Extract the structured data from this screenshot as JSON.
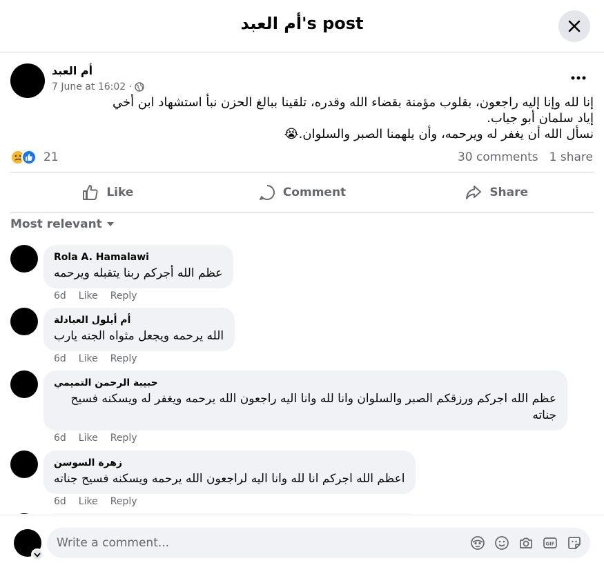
{
  "header": {
    "title": "أم العبد's post"
  },
  "post": {
    "author": "أم العبد",
    "timestamp": "7 June at 16:02 ·",
    "privacy_icon": "globe-icon",
    "lines": [
      "إنا لله وإنا إليه راجعون، بقلوب مؤمنة بقضاء الله وقدره، تلقينا ببالغ الحزن نبأ استشهاد ابن أخي",
      "إياد سلمان أبو جياب.",
      "نسأل الله أن يغفر له ويرحمه، وأن يلهمنا الصبر والسلوان.😭"
    ],
    "reaction_count": "21",
    "comments_count": "30 comments",
    "shares_count": "1 share"
  },
  "actions": {
    "like": "Like",
    "comment": "Comment",
    "share": "Share"
  },
  "sort": {
    "label": "Most relevant"
  },
  "comments": [
    {
      "name": "Rola A. Hamalawi",
      "text": "عظم الله أجركم ربنا يتقبله ويرحمه",
      "time": "6d",
      "like": "Like",
      "reply": "Reply"
    },
    {
      "name": "أم أيلول العبادلة",
      "text": "الله يرحمه ويجعل مثواه الجنه يارب",
      "time": "6d",
      "like": "Like",
      "reply": "Reply"
    },
    {
      "name": "حبيبة الرحمن التميمي",
      "text1": "عظم الله اجركم ورزقكم الصبر والسلوان وانا لله وانا اليه راجعون الله يرحمه ويغفر له ويسكنه فسيح",
      "text2": "جناته",
      "time": "6d",
      "like": "Like",
      "reply": "Reply"
    },
    {
      "name": "زهرة السوسن",
      "text": "اعظم الله اجركم انا لله وانا اليه لراجعون الله يرحمه ويسكنه فسيح جناته",
      "time": "6d",
      "like": "Like",
      "reply": "Reply"
    }
  ],
  "composer": {
    "placeholder": "Write a comment..."
  },
  "colors": {
    "like_blue": "#1877f2",
    "care_yellow": "#f7b928",
    "secondary_text": "#65676b",
    "bubble_bg": "#f0f2f5"
  }
}
